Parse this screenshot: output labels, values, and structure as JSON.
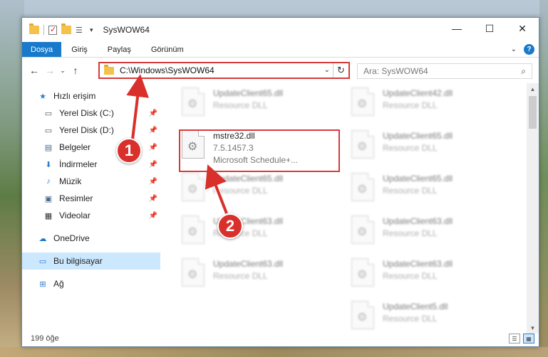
{
  "window": {
    "title": "SysWOW64"
  },
  "ribbon": {
    "tabs": [
      "Dosya",
      "Giriş",
      "Paylaş",
      "Görünüm"
    ],
    "help": "?"
  },
  "address": {
    "path": "C:\\Windows\\SysWOW64",
    "search_placeholder": "Ara: SysWOW64"
  },
  "nav": {
    "items": [
      {
        "label": "Hızlı erişim",
        "icon": "star-icon",
        "pinned": false
      },
      {
        "label": "Yerel Disk (C:)",
        "icon": "drive-icon",
        "pinned": true
      },
      {
        "label": "Yerel Disk (D:)",
        "icon": "drive-icon",
        "pinned": true
      },
      {
        "label": "Belgeler",
        "icon": "documents-icon",
        "pinned": true
      },
      {
        "label": "İndirmeler",
        "icon": "download-icon",
        "pinned": true
      },
      {
        "label": "Müzik",
        "icon": "music-icon",
        "pinned": true
      },
      {
        "label": "Resimler",
        "icon": "pictures-icon",
        "pinned": true
      },
      {
        "label": "Videolar",
        "icon": "video-icon",
        "pinned": true
      },
      {
        "label": "OneDrive",
        "icon": "cloud-icon",
        "pinned": false
      },
      {
        "label": "Bu bilgisayar",
        "icon": "computer-icon",
        "pinned": false,
        "selected": true
      },
      {
        "label": "Ağ",
        "icon": "network-icon",
        "pinned": false
      }
    ]
  },
  "files": {
    "highlighted": {
      "name": "mstre32.dll",
      "version": "7.5.1457.3",
      "description": "Microsoft Schedule+..."
    },
    "left_column": [
      {
        "name": "UpdateClient65.dll",
        "type": "Resource DLL"
      },
      {
        "name": "UpdateClient65.dll",
        "type": "Resource DLL"
      },
      {
        "name": "UpdateClient63.dll",
        "type": "Resource DLL"
      },
      {
        "name": "UpdateClient63.dll",
        "type": "Resource DLL"
      }
    ],
    "right_column": [
      {
        "name": "UpdateClient42.dll",
        "type": "Resource DLL"
      },
      {
        "name": "UpdateClient65.dll",
        "type": "Resource DLL"
      },
      {
        "name": "UpdateClient65.dll",
        "type": "Resource DLL"
      },
      {
        "name": "UpdateClient63.dll",
        "type": "Resource DLL"
      },
      {
        "name": "UpdateClient63.dll",
        "type": "Resource DLL"
      },
      {
        "name": "UpdateClient5.dll",
        "type": "Resource DLL"
      }
    ]
  },
  "callouts": [
    "1",
    "2"
  ],
  "status": {
    "count": "199 öğe"
  },
  "colors": {
    "accent": "#1979ca",
    "highlight": "#d63a3a",
    "selected": "#cce8ff"
  }
}
